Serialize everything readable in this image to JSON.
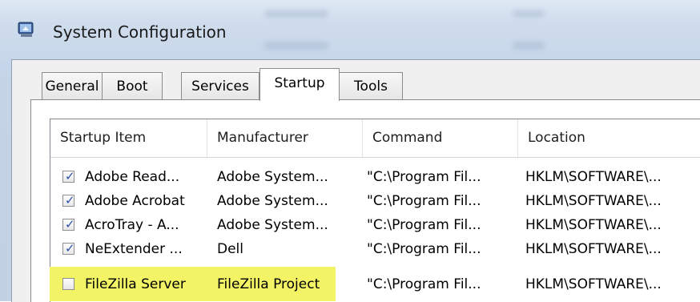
{
  "window": {
    "title": "System Configuration",
    "icon": "msconfig-icon"
  },
  "tabs": [
    {
      "label": "General",
      "active": false
    },
    {
      "label": "Boot",
      "active": false
    },
    {
      "label": "Services",
      "active": false
    },
    {
      "label": "Startup",
      "active": true
    },
    {
      "label": "Tools",
      "active": false
    }
  ],
  "list": {
    "columns": [
      "Startup Item",
      "Manufacturer",
      "Command",
      "Location"
    ],
    "rows": [
      {
        "checked": true,
        "item": "Adobe Read...",
        "manufacturer": "Adobe System...",
        "command": "\"C:\\Program Fil...",
        "location": "HKLM\\SOFTWARE\\..."
      },
      {
        "checked": true,
        "item": "Adobe Acrobat",
        "manufacturer": "Adobe System...",
        "command": "\"C:\\Program Fil...",
        "location": "HKLM\\SOFTWARE\\..."
      },
      {
        "checked": true,
        "item": "AcroTray - A...",
        "manufacturer": "Adobe System...",
        "command": "\"C:\\Program Fil...",
        "location": "HKLM\\SOFTWARE\\..."
      },
      {
        "checked": true,
        "item": "NeExtender ...",
        "manufacturer": "Dell",
        "command": "\"C:\\Program Fil...",
        "location": "HKLM\\SOFTWARE\\..."
      },
      {
        "checked": false,
        "item": "FileZilla Server",
        "manufacturer": "FileZilla Project",
        "command": "\"C:\\Program Fil...",
        "location": "HKLM\\SOFTWARE\\..."
      }
    ]
  },
  "colors": {
    "highlight": "#f3f366",
    "checkmark": "#2a4fa6"
  }
}
